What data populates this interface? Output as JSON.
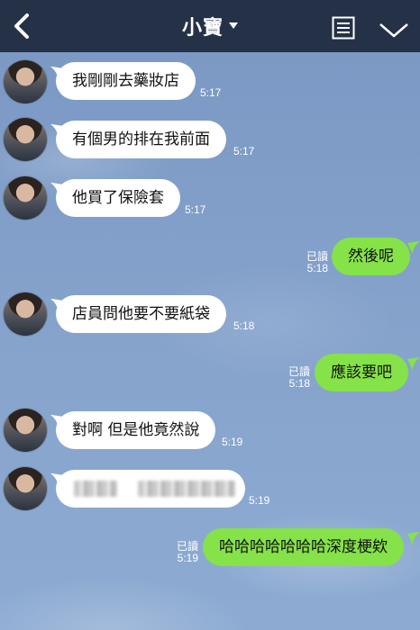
{
  "header": {
    "title": "小寶",
    "back_icon": "chevron-left-icon",
    "menu_icon": "list-icon",
    "more_icon": "chevron-down-icon"
  },
  "messages": [
    {
      "side": "in",
      "text": "我剛剛去藥妝店",
      "time": "5:17"
    },
    {
      "side": "in",
      "text": "有個男的排在我前面",
      "time": "5:17"
    },
    {
      "side": "in",
      "text": "他買了保險套",
      "time": "5:17"
    },
    {
      "side": "out",
      "text": "然後呢",
      "read": "已讀",
      "time": "5:18"
    },
    {
      "side": "in",
      "text": "店員問他要不要紙袋",
      "time": "5:18"
    },
    {
      "side": "out",
      "text": "應該要吧",
      "read": "已讀",
      "time": "5:18"
    },
    {
      "side": "in",
      "text": "對啊 但是他竟然說",
      "time": "5:19"
    },
    {
      "side": "in",
      "text": "",
      "time": "5:19",
      "blurred": true
    },
    {
      "side": "out",
      "text": "哈哈哈哈哈哈哈深度梗欸",
      "read": "已讀",
      "time": "5:19"
    }
  ],
  "colors": {
    "header_bg": "#253147",
    "chat_bg": "#7f9ec7",
    "bubble_in": "#ffffff",
    "bubble_out": "#85e249"
  }
}
